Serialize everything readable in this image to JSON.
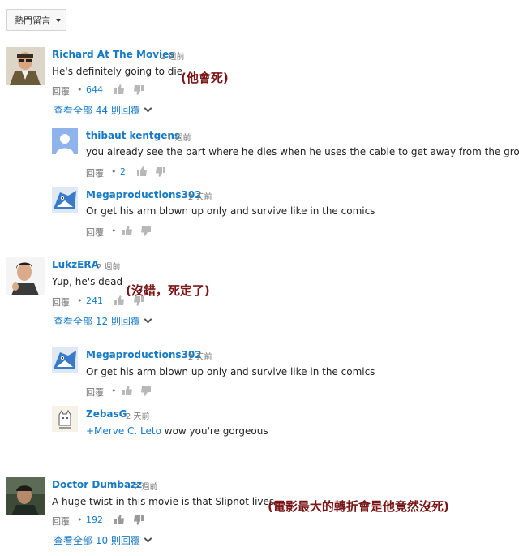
{
  "sort": {
    "label": "熱門留言"
  },
  "comments": [
    {
      "author": "Richard At The Movies",
      "time": "2 週前",
      "text": "He's definitely going to die.",
      "reply": "回覆",
      "likes": "644",
      "view_all": "查看全部 44 則回覆",
      "annotation": "(他會死)"
    },
    {
      "author": "thibaut kentgens",
      "time": "1 週前",
      "text": "you already see the part where he dies when he uses the cable to get away from the group",
      "reply": "回覆",
      "likes": "2"
    },
    {
      "author": "Megaproductions302",
      "time": "2 天前",
      "text": "Or get his arm blown up only and survive like in the comics",
      "reply": "回覆"
    },
    {
      "author": "LukzERA",
      "time": "2 週前",
      "text": "Yup, he's dead",
      "reply": "回覆",
      "likes": "241",
      "view_all": "查看全部 12 則回覆",
      "annotation": "(沒錯，死定了)"
    },
    {
      "author": "Megaproductions302",
      "time": "2 天前",
      "text": "Or get his arm blown up only and survive like in the comics",
      "reply": "回覆"
    },
    {
      "author": "ZebasG",
      "time": "2 天前",
      "mention": "+Merve C. Leto",
      "text": " wow you're gorgeous"
    },
    {
      "author": "Doctor Dumbazz",
      "time": "2 週前",
      "text": "A huge twist in this movie is that Slipnot lives.",
      "reply": "回覆",
      "likes": "192",
      "view_all": "查看全部 10 則回覆",
      "annotation": "(電影最大的轉折會是他竟然沒死)"
    }
  ],
  "colors": {
    "link": "#167ac6",
    "annotation": "#7a1616",
    "meta": "#767676"
  }
}
